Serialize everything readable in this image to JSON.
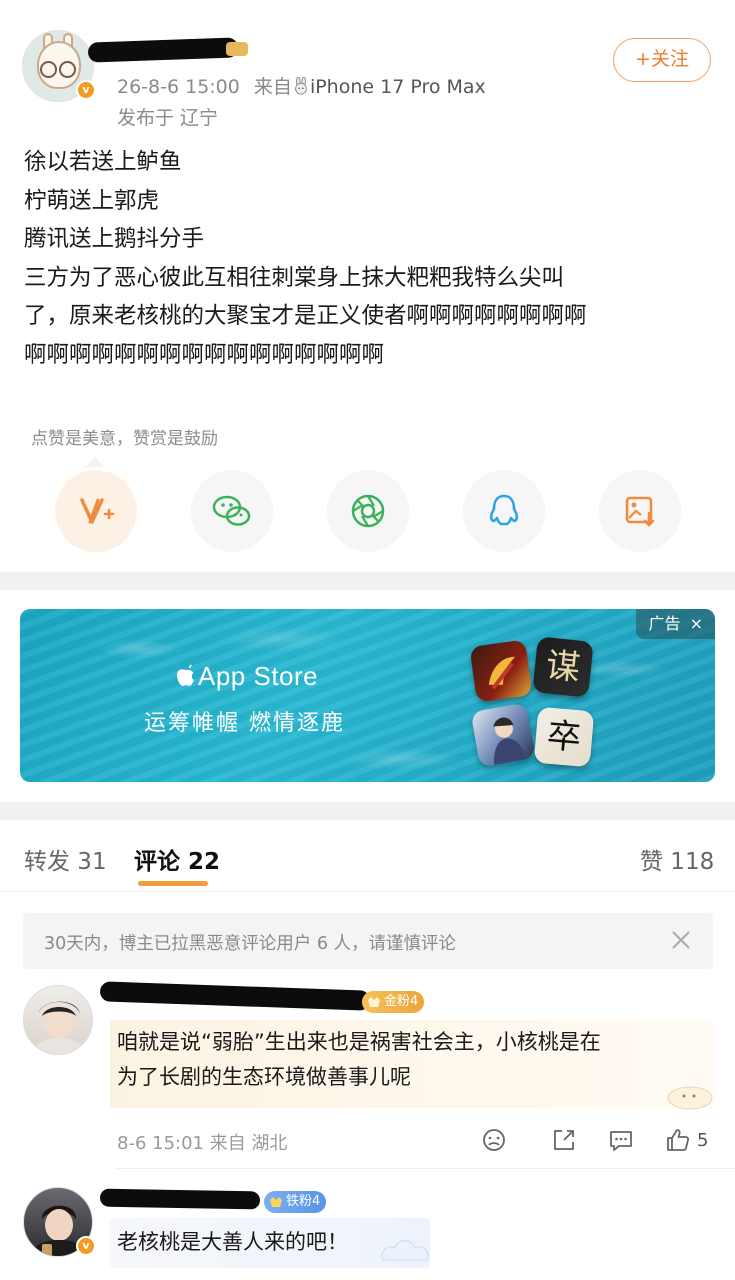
{
  "post": {
    "timestamp": "26-8-6 15:00",
    "source_prefix": "来自",
    "device": "iPhone 17 Pro Max",
    "location": "发布于 辽宁",
    "follow_label": "+关注",
    "content_lines": [
      "徐以若送上鲈鱼",
      "柠萌送上郭虎",
      "腾讯送上鹅抖分手",
      "三方为了恶心彼此互相往刺棠身上抹大粑粑我特么尖叫",
      "了，原来老核桃的大聚宝才是正义使者啊啊啊啊啊啊啊啊",
      "啊啊啊啊啊啊啊啊啊啊啊啊啊啊啊啊"
    ],
    "reward_hint": "点赞是美意，赞赏是鼓励",
    "share_icons": [
      "reward-icon",
      "wechat-icon",
      "moments-icon",
      "qq-icon",
      "save-image-icon"
    ]
  },
  "ad": {
    "tag_label": "广告",
    "close_glyph": "×",
    "store_name": "App Store",
    "slogan": "运筹帷幄 燃情逐鹿",
    "game_icon_glyphs": [
      "谋",
      "卒"
    ]
  },
  "tabs": {
    "repost": "转发 31",
    "comments": "评论 22",
    "likes": "赞 118"
  },
  "notice": {
    "text": "30天内，博主已拉黑恶意评论用户 6 人，请谨慎评论"
  },
  "comments": [
    {
      "badge": "金粉4",
      "text_lines": [
        "咱就是说“弱胎”生出来也是祸害社会主，小核桃是在",
        "为了长剧的生态环境做善事儿呢"
      ],
      "meta": "8-6 15:01 来自 湖北",
      "like_count": "5"
    },
    {
      "badge": "铁粉4",
      "text_lines": [
        "老核桃是大善人来的吧！"
      ]
    }
  ],
  "colors": {
    "accent_orange": "#ef7d2d",
    "tab_underline": "#f29b3a",
    "ad_blue": "#29b9d2"
  }
}
